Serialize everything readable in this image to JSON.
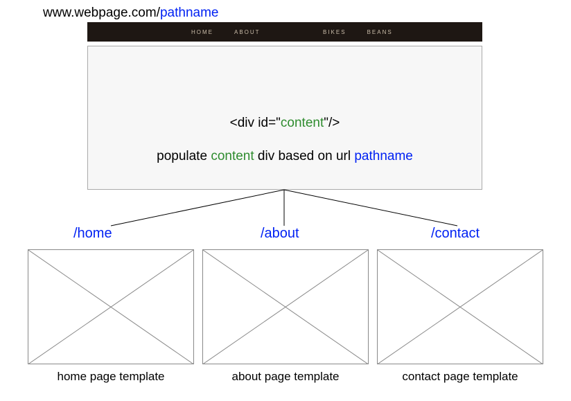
{
  "url": {
    "base": "www.webpage.com/",
    "pathname": "pathname"
  },
  "nav": {
    "home": "HOME",
    "about": "ABOUT",
    "bikes": "BIKES",
    "beans": "BEANS"
  },
  "codeLine": {
    "open": "<div id=\"",
    "id": "content",
    "close": "\"/>"
  },
  "desc": {
    "p1": "populate ",
    "content": "content",
    "p2": " div based on url ",
    "pathname": "pathname"
  },
  "routes": {
    "home": "/home",
    "about": "/about",
    "contact": "/contact"
  },
  "captions": {
    "home": "home page template",
    "about": "about page template",
    "contact": "contact page template"
  }
}
